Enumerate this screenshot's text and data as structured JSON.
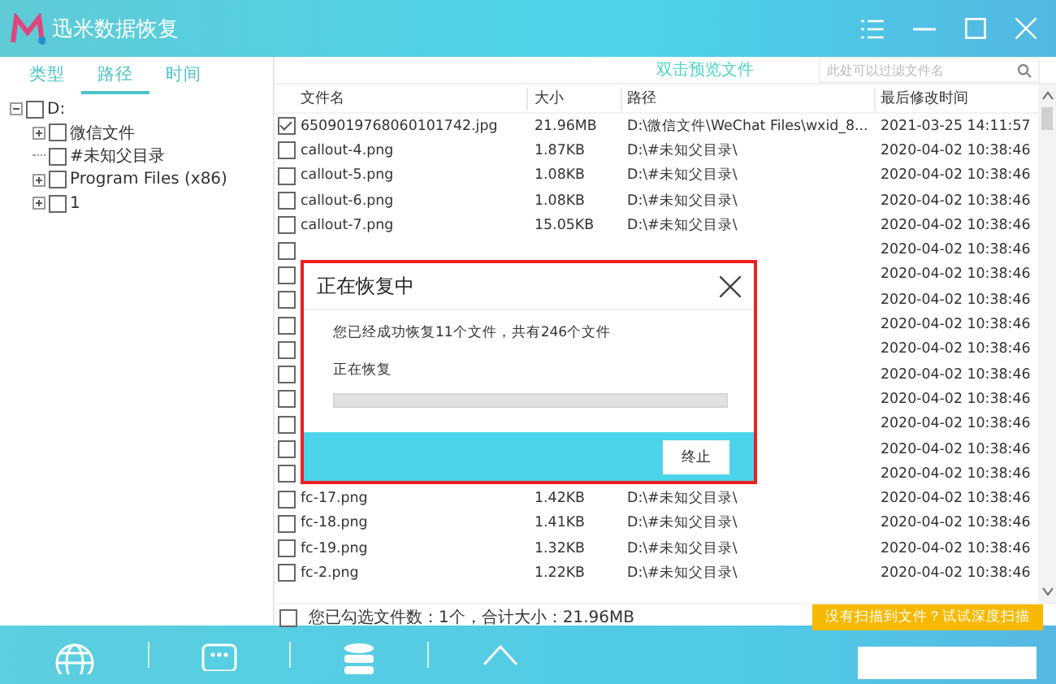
{
  "window": {
    "title": "迅米数据恢复"
  },
  "tabs": [
    {
      "label": "类型",
      "selected": false
    },
    {
      "label": "路径",
      "selected": true
    },
    {
      "label": "时间",
      "selected": false
    }
  ],
  "preview_hint": "双击预览文件",
  "search": {
    "placeholder": "此处可以过滤文件名"
  },
  "tree": [
    {
      "label": "D:",
      "checked": false,
      "expanded": true,
      "children": [
        {
          "label": "微信文件",
          "checked": false,
          "expanded": false
        },
        {
          "label": "#未知父目录",
          "checked": false
        },
        {
          "label": "Program Files (x86)",
          "checked": false,
          "expanded": false
        },
        {
          "label": "1",
          "checked": false,
          "expanded": false
        }
      ]
    }
  ],
  "table": {
    "columns": [
      "文件名",
      "大小",
      "路径",
      "最后修改时间"
    ],
    "rows": [
      {
        "checked": true,
        "name": "6509019768060101742.jpg",
        "size": "21.96MB",
        "path": "D:\\微信文件\\WeChat Files\\wxid_8...",
        "modified": "2021-03-25 14:11:57"
      },
      {
        "checked": false,
        "name": "callout-4.png",
        "size": "1.87KB",
        "path": "D:\\#未知父目录\\",
        "modified": "2020-04-02 10:38:46"
      },
      {
        "checked": false,
        "name": "callout-5.png",
        "size": "1.08KB",
        "path": "D:\\#未知父目录\\",
        "modified": "2020-04-02 10:38:46"
      },
      {
        "checked": false,
        "name": "callout-6.png",
        "size": "1.08KB",
        "path": "D:\\#未知父目录\\",
        "modified": "2020-04-02 10:38:46"
      },
      {
        "checked": false,
        "name": "callout-7.png",
        "size": "15.05KB",
        "path": "D:\\#未知父目录\\",
        "modified": "2020-04-02 10:38:46"
      },
      {
        "checked": false,
        "modified": "2020-04-02 10:38:46"
      },
      {
        "checked": false,
        "modified": "2020-04-02 10:38:46"
      },
      {
        "checked": false,
        "modified": "2020-04-02 10:38:46"
      },
      {
        "checked": false,
        "modified": "2020-04-02 10:38:46"
      },
      {
        "checked": false,
        "modified": "2020-04-02 10:38:46"
      },
      {
        "checked": false,
        "modified": "2020-04-02 10:38:46"
      },
      {
        "checked": false,
        "modified": "2020-04-02 10:38:46"
      },
      {
        "checked": false,
        "modified": "2020-04-02 10:38:46"
      },
      {
        "checked": false,
        "modified": "2020-04-02 10:38:46"
      },
      {
        "checked": false,
        "modified": "2020-04-02 10:38:46"
      },
      {
        "checked": false,
        "name": "fc-17.png",
        "size": "1.42KB",
        "path": "D:\\#未知父目录\\",
        "modified": "2020-04-02 10:38:46"
      },
      {
        "checked": false,
        "name": "fc-18.png",
        "size": "1.41KB",
        "path": "D:\\#未知父目录\\",
        "modified": "2020-04-02 10:38:46"
      },
      {
        "checked": false,
        "name": "fc-19.png",
        "size": "1.32KB",
        "path": "D:\\#未知父目录\\",
        "modified": "2020-04-02 10:38:46"
      },
      {
        "checked": false,
        "name": "fc-2.png",
        "size": "1.22KB",
        "path": "D:\\#未知父目录\\",
        "modified": "2020-04-02 10:38:46"
      }
    ]
  },
  "status": {
    "checked": false,
    "text": "您已勾选文件数：1个，合计大小：21.96MB"
  },
  "deep_scan_button": "没有扫描到文件？试试深度扫描",
  "dialog": {
    "title": "正在恢复中",
    "message": "您已经成功恢复11个文件，共有246个文件",
    "progress_label": "正在恢复",
    "level": 0,
    "button": "终止"
  }
}
